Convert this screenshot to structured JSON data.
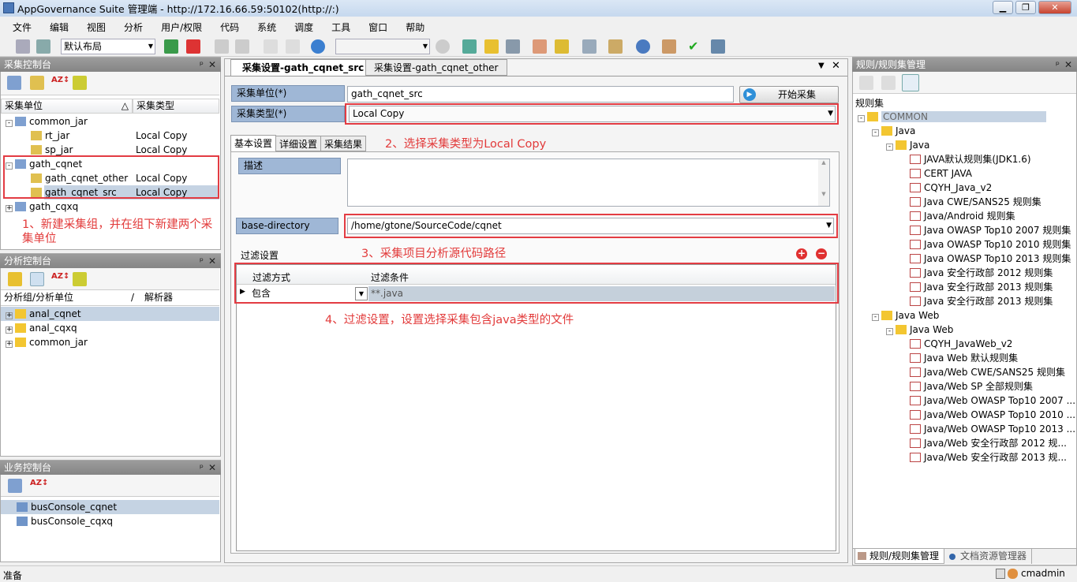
{
  "window": {
    "title": "AppGovernance Suite 管理端 - http://172.16.66.59:50102(http://:)",
    "minimize": "▁",
    "maximize": "❐",
    "close": "✕"
  },
  "menu": [
    "文件",
    "编辑",
    "视图",
    "分析",
    "用户/权限",
    "代码",
    "系统",
    "调度",
    "工具",
    "窗口",
    "帮助"
  ],
  "toolbar": {
    "layout_value": "默认布局",
    "search_value": ""
  },
  "collect_console": {
    "title": "采集控制台",
    "col_unit": "采集单位",
    "sort_glyph": "△",
    "col_type": "采集类型",
    "tree": [
      {
        "label": "common_jar",
        "type": "",
        "level": 0,
        "kind": "group",
        "exp": "-"
      },
      {
        "label": "rt_jar",
        "type": "Local Copy",
        "level": 1,
        "kind": "unit"
      },
      {
        "label": "sp_jar",
        "type": "Local Copy",
        "level": 1,
        "kind": "unit"
      },
      {
        "label": "gath_cqnet",
        "type": "",
        "level": 0,
        "kind": "group",
        "exp": "-"
      },
      {
        "label": "gath_cqnet_other",
        "type": "Local Copy",
        "level": 1,
        "kind": "unit"
      },
      {
        "label": "gath_cqnet_src",
        "type": "Local Copy",
        "level": 1,
        "kind": "unit",
        "selected": true
      },
      {
        "label": "gath_cqxq",
        "type": "",
        "level": 0,
        "kind": "group",
        "exp": "+"
      }
    ],
    "annotation": "1、新建采集组，并在组下新建两个采集单位"
  },
  "analysis_console": {
    "title": "分析控制台",
    "col_group": "分析组/分析单位",
    "col_sep": "/",
    "col_parser": "解析器",
    "tree": [
      {
        "label": "anal_cqnet",
        "selected": true
      },
      {
        "label": "anal_cqxq"
      },
      {
        "label": "common_jar"
      }
    ]
  },
  "business_console": {
    "title": "业务控制台",
    "items": [
      {
        "label": "busConsole_cqnet",
        "selected": true
      },
      {
        "label": "busConsole_cqxq"
      }
    ]
  },
  "editor": {
    "tabs": [
      {
        "label": "采集设置-gath_cqnet_src",
        "active": true
      },
      {
        "label": "采集设置-gath_cqnet_other"
      }
    ],
    "unit_label": "采集单位(*)",
    "unit_value": "gath_cqnet_src",
    "start_button": "开始采集",
    "type_label": "采集类型(*)",
    "type_value": "Local Copy",
    "subtabs": [
      "基本设置",
      "详细设置",
      "采集结果"
    ],
    "annotation2": "2、选择采集类型为Local Copy",
    "desc_label": "描述",
    "desc_value": "",
    "basedir_label": "base-directory",
    "basedir_value": "/home/gtone/SourceCode/cqnet",
    "annotation3": "3、采集项目分析源代码路径",
    "filter_title": "过滤设置",
    "filter_col_mode": "过滤方式",
    "filter_col_cond": "过滤条件",
    "filter_rows": [
      {
        "mode": "包含",
        "cond": "**.java"
      }
    ],
    "annotation4": "4、过滤设置，设置选择采集包含java类型的文件"
  },
  "rules": {
    "title": "规则/规则集管理",
    "col": "规则集",
    "tree": [
      {
        "label": "COMMON",
        "level": 0,
        "folder": true,
        "selected": true
      },
      {
        "label": "Java",
        "level": 1,
        "folder": true
      },
      {
        "label": "Java",
        "level": 2,
        "folder": true
      },
      {
        "label": "JAVA默认规则集(JDK1.6)",
        "level": 3
      },
      {
        "label": "CERT JAVA",
        "level": 3
      },
      {
        "label": "CQYH_Java_v2",
        "level": 3
      },
      {
        "label": "Java CWE/SANS25 规则集",
        "level": 3
      },
      {
        "label": "Java/Android 规则集",
        "level": 3
      },
      {
        "label": "Java OWASP Top10 2007 规则集",
        "level": 3
      },
      {
        "label": "Java OWASP Top10 2010 规则集",
        "level": 3
      },
      {
        "label": "Java OWASP Top10 2013 规则集",
        "level": 3
      },
      {
        "label": "Java 安全行政部 2012 规则集",
        "level": 3
      },
      {
        "label": "Java 安全行政部 2013 规则集",
        "level": 3
      },
      {
        "label": "Java 安全行政部 2013 规则集",
        "level": 3
      },
      {
        "label": "Java Web",
        "level": 1,
        "folder": true
      },
      {
        "label": "Java Web",
        "level": 2,
        "folder": true
      },
      {
        "label": "CQYH_JavaWeb_v2",
        "level": 3
      },
      {
        "label": "Java Web 默认规则集",
        "level": 3
      },
      {
        "label": "Java/Web CWE/SANS25 规则集",
        "level": 3
      },
      {
        "label": "Java/Web SP 全部规则集",
        "level": 3
      },
      {
        "label": "Java/Web OWASP Top10 2007 ...",
        "level": 3
      },
      {
        "label": "Java/Web OWASP Top10 2010 ...",
        "level": 3
      },
      {
        "label": "Java/Web OWASP Top10 2013 ...",
        "level": 3
      },
      {
        "label": "Java/Web 安全行政部 2012 规...",
        "level": 3
      },
      {
        "label": "Java/Web 安全行政部 2013 规...",
        "level": 3
      }
    ],
    "bottom_tabs": [
      "规则/规则集管理",
      "文档资源管理器"
    ]
  },
  "status": {
    "text": "准备",
    "user": "cmadmin"
  },
  "colors": {
    "annotation": "#e23a3a",
    "label_bg": "#9fb7d6",
    "selection": "#c5d3e3"
  }
}
